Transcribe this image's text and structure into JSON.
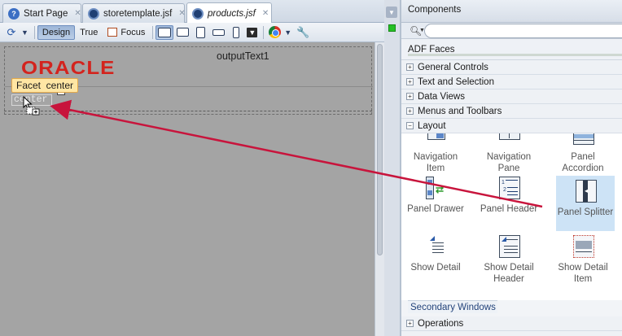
{
  "tabs": [
    {
      "label": "Start Page",
      "icon": "help-icon"
    },
    {
      "label": "storetemplate.jsf",
      "icon": "jsf-file-icon"
    },
    {
      "label": "products.jsf",
      "icon": "jsf-file-icon",
      "active": true
    }
  ],
  "toolbar": {
    "design_label": "Design",
    "true_label": "True",
    "focus_label": "Focus"
  },
  "canvas": {
    "logo_text": "ORACLE",
    "output_text": "outputText1",
    "facet_tooltip": "Facet  center",
    "facet_placeholder": "center"
  },
  "palette": {
    "title": "Components",
    "library": "ADF Faces",
    "categories_top": [
      {
        "label": "General Controls",
        "toggle": "+"
      },
      {
        "label": "Text and Selection",
        "toggle": "+"
      },
      {
        "label": "Data Views",
        "toggle": "+"
      },
      {
        "label": "Menus and Toolbars",
        "toggle": "+"
      },
      {
        "label": "Layout",
        "toggle": "−"
      }
    ],
    "components": [
      {
        "label1": "Navigation",
        "label2": "Item"
      },
      {
        "label1": "Navigation",
        "label2": "Pane"
      },
      {
        "label1": "Panel",
        "label2": "Accordion"
      },
      {
        "label1": "Panel Drawer",
        "label2": ""
      },
      {
        "label1": "Panel Header",
        "label2": ""
      },
      {
        "label1": "Panel Splitter",
        "label2": "",
        "selected": true
      },
      {
        "label1": "Show Detail",
        "label2": ""
      },
      {
        "label1": "Show Detail",
        "label2": "Header"
      },
      {
        "label1": "Show Detail",
        "label2": "Item"
      }
    ],
    "subcategory": "Secondary Windows",
    "categories_bottom": [
      {
        "label": "Operations",
        "toggle": "+"
      }
    ]
  },
  "colors": {
    "oracle_red": "#d3241e",
    "annotation_arrow": "#c8143c",
    "canvas_gray": "#a4a4a4",
    "tooltip_bg": "#ffe6a4",
    "selection_bg": "#cde3f6"
  }
}
